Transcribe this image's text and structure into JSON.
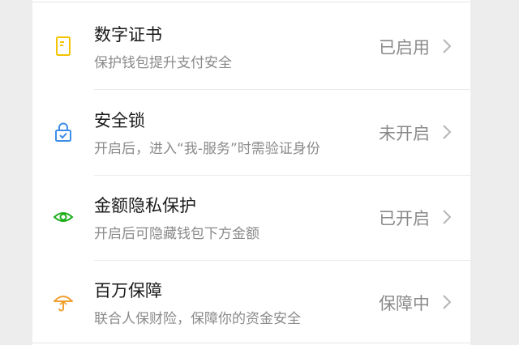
{
  "settings": {
    "items": [
      {
        "id": "digital-certificate",
        "title": "数字证书",
        "subtitle": "保护钱包提升支付安全",
        "status": "已启用",
        "icon": "certificate-icon",
        "icon_color": "#f5c400"
      },
      {
        "id": "security-lock",
        "title": "安全锁",
        "subtitle": "开启后，进入“我-服务”时需验证身份",
        "status": "未开启",
        "icon": "lock-icon",
        "icon_color": "#3d8ee8"
      },
      {
        "id": "amount-privacy",
        "title": "金额隐私保护",
        "subtitle": "开启后可隐藏钱包下方金额",
        "status": "已开启",
        "icon": "eye-icon",
        "icon_color": "#1aad19"
      },
      {
        "id": "million-guarantee",
        "title": "百万保障",
        "subtitle": "联合人保财险，保障你的资金安全",
        "status": "保障中",
        "icon": "umbrella-icon",
        "icon_color": "#f0a030"
      }
    ],
    "chevron_icon": "chevron-right-icon"
  }
}
